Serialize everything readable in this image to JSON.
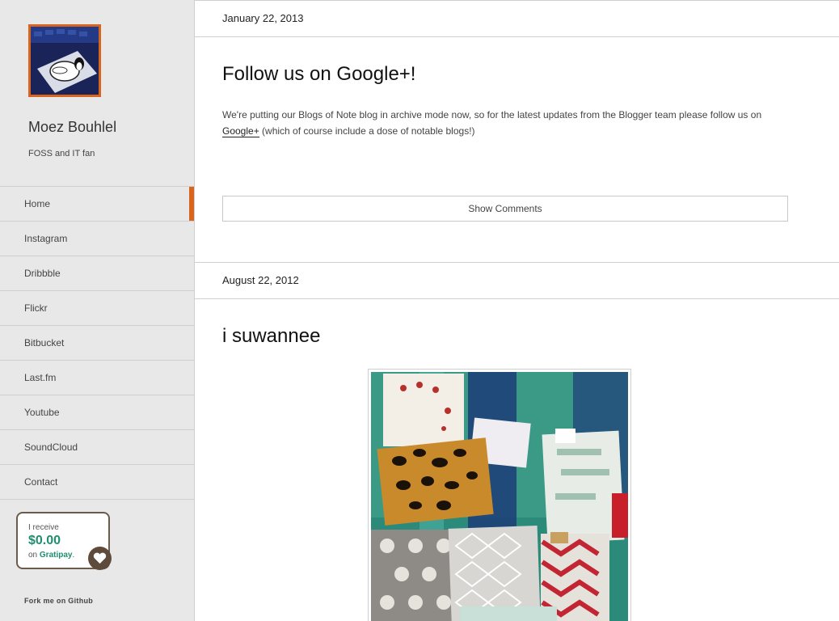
{
  "sidebar": {
    "site_title": "Moez Bouhlel",
    "site_description": "FOSS and IT fan",
    "nav_items": [
      {
        "label": "Home",
        "active": true
      },
      {
        "label": "Instagram",
        "active": false
      },
      {
        "label": "Dribbble",
        "active": false
      },
      {
        "label": "Flickr",
        "active": false
      },
      {
        "label": "Bitbucket",
        "active": false
      },
      {
        "label": "Last.fm",
        "active": false
      },
      {
        "label": "Youtube",
        "active": false
      },
      {
        "label": "SoundCloud",
        "active": false
      },
      {
        "label": "Contact",
        "active": false
      }
    ],
    "gratipay": {
      "line1": "I receive",
      "amount": "$0.00",
      "on": "on",
      "brand": "Gratipay",
      "period": "."
    },
    "fork_label": "Fork me on Github"
  },
  "posts": [
    {
      "date": "January 22, 2013",
      "title": "Follow us on Google+!",
      "body_before": "We're putting our Blogs of Note blog in archive mode now, so for the latest updates from the Blogger team please follow us on ",
      "link_text": "Google+",
      "body_after": " (which of course include a dose of notable blogs!)",
      "comments_button": "Show Comments"
    },
    {
      "date": "August 22, 2012",
      "title": "i suwannee"
    }
  ],
  "colors": {
    "accent": "#d9641d",
    "sidebar_bg": "#e8e8e8",
    "gratipay_green": "#1e8e6f"
  }
}
